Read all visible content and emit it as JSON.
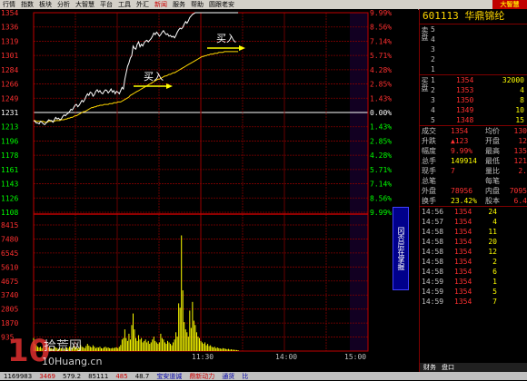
{
  "menu": {
    "items": [
      "行情",
      "指数",
      "板块",
      "分析",
      "大智慧",
      "平台",
      "工具",
      "外汇",
      "新闻",
      "服务",
      "帮助",
      "圆跟老安"
    ],
    "highlight_index": 8,
    "brand": "大智慧"
  },
  "chart": {
    "price_labels": [
      "1354",
      "1336",
      "1319",
      "1301",
      "1284",
      "1266",
      "1249",
      "1231",
      "1213",
      "1196",
      "1178",
      "1161",
      "1143",
      "1126",
      "1108"
    ],
    "pct_labels": [
      "9.99%",
      "8.56%",
      "7.14%",
      "5.71%",
      "4.28%",
      "2.85%",
      "1.43%",
      "0.00%",
      "1.43%",
      "2.85%",
      "4.28%",
      "5.71%",
      "7.14%",
      "8.56%",
      "9.99%"
    ],
    "volume_labels": [
      "8415",
      "7480",
      "6545",
      "5610",
      "4675",
      "3740",
      "2805",
      "1870",
      "935"
    ],
    "time_labels": [
      "11:30",
      "14:00",
      "15:00"
    ],
    "annotations": [
      "买入",
      "买入"
    ],
    "side_button": "冈否层在掌握",
    "price_series": [
      1221,
      1220,
      1218,
      1218,
      1217,
      1220,
      1219,
      1217,
      1216,
      1218,
      1220,
      1222,
      1221,
      1221,
      1219,
      1222,
      1225,
      1223,
      1224,
      1222,
      1223,
      1226,
      1228,
      1227,
      1229,
      1230,
      1232,
      1235,
      1234,
      1237,
      1240,
      1241,
      1238,
      1240,
      1243,
      1246,
      1244,
      1247,
      1251,
      1254,
      1252,
      1256,
      1255,
      1251,
      1253,
      1257,
      1259,
      1256,
      1258,
      1255,
      1254,
      1257,
      1259,
      1258,
      1255,
      1257,
      1260,
      1256,
      1258,
      1254,
      1257,
      1256,
      1254,
      1258,
      1262,
      1260,
      1272,
      1280,
      1288,
      1292,
      1298,
      1301,
      1313,
      1310,
      1309,
      1315,
      1318,
      1312,
      1315,
      1313,
      1317,
      1319,
      1320,
      1318,
      1320,
      1322,
      1325,
      1329,
      1327,
      1330,
      1328,
      1325,
      1327,
      1330,
      1332,
      1329,
      1327,
      1328,
      1325,
      1326,
      1324,
      1325,
      1323,
      1326,
      1330,
      1333,
      1335,
      1334,
      1336,
      1340,
      1343,
      1341,
      1344,
      1348,
      1350,
      1352,
      1353,
      1354,
      1354,
      1354,
      1354,
      1354,
      1354,
      1354,
      1354,
      1354,
      1354,
      1354,
      1354,
      1354,
      1354,
      1354,
      1354,
      1354,
      1354,
      1354,
      1354,
      1354,
      1354,
      1354,
      1354,
      1354,
      1354,
      1354,
      1354,
      1354,
      1354,
      1354,
      1354
    ],
    "avg_series": [
      1221,
      1221,
      1220,
      1220,
      1220,
      1220,
      1220,
      1220,
      1219,
      1219,
      1219,
      1220,
      1220,
      1220,
      1220,
      1220,
      1221,
      1221,
      1221,
      1221,
      1222,
      1222,
      1222,
      1223,
      1223,
      1224,
      1224,
      1225,
      1225,
      1226,
      1227,
      1227,
      1228,
      1229,
      1230,
      1231,
      1232,
      1232,
      1233,
      1234,
      1235,
      1236,
      1237,
      1237,
      1238,
      1238,
      1239,
      1239,
      1240,
      1240,
      1240,
      1241,
      1241,
      1241,
      1241,
      1242,
      1242,
      1242,
      1243,
      1243,
      1243,
      1244,
      1244,
      1244,
      1245,
      1246,
      1247,
      1248,
      1249,
      1250,
      1252,
      1253,
      1254,
      1255,
      1256,
      1257,
      1258,
      1259,
      1260,
      1261,
      1262,
      1263,
      1264,
      1265,
      1266,
      1267,
      1268,
      1269,
      1270,
      1271,
      1272,
      1272,
      1273,
      1274,
      1275,
      1276,
      1276,
      1277,
      1278,
      1278,
      1279,
      1280,
      1280,
      1281,
      1282,
      1283,
      1284,
      1285,
      1286,
      1287,
      1288,
      1289,
      1290,
      1291,
      1292,
      1293,
      1294,
      1295,
      1296,
      1297,
      1298,
      1299,
      1300,
      1300,
      1301,
      1301,
      1302,
      1302,
      1303,
      1303,
      1303,
      1304,
      1304,
      1304,
      1305,
      1305,
      1305,
      1305,
      1306,
      1306,
      1306,
      1306,
      1306,
      1306,
      1306,
      1306,
      1306,
      1306,
      1306
    ],
    "volume_series": [
      900,
      500,
      400,
      300,
      250,
      300,
      200,
      350,
      250,
      300,
      200,
      250,
      180,
      200,
      150,
      300,
      250,
      200,
      150,
      180,
      200,
      220,
      160,
      180,
      250,
      200,
      300,
      260,
      200,
      350,
      260,
      300,
      200,
      250,
      420,
      300,
      260,
      200,
      350,
      500,
      380,
      300,
      250,
      400,
      300,
      200,
      260,
      240,
      300,
      200,
      180,
      260,
      300,
      220,
      250,
      200,
      180,
      220,
      200,
      240,
      260,
      200,
      300,
      420,
      800,
      900,
      1500,
      900,
      700,
      1200,
      800,
      1800,
      2600,
      1500,
      900,
      700,
      1100,
      800,
      900,
      600,
      700,
      800,
      600,
      700,
      500,
      600,
      800,
      1000,
      700,
      600,
      500,
      600,
      1200,
      900,
      800,
      600,
      500,
      700,
      600,
      500,
      400,
      600,
      800,
      1300,
      1000,
      3300,
      3000,
      8000,
      4200,
      2000,
      1500,
      1300,
      1000,
      2800,
      1600,
      3400,
      2100,
      1800,
      1300,
      1000,
      900,
      700,
      600,
      500,
      600,
      400,
      500,
      350,
      400,
      300,
      250,
      300,
      200,
      250,
      200,
      180,
      150,
      200,
      180,
      150,
      120,
      150,
      100,
      120,
      100,
      90,
      80,
      70,
      60
    ]
  },
  "quote": {
    "code": "601113",
    "name": "华鼎锦纶",
    "sell_label": "卖盘",
    "buy_label": "买盘",
    "sell": [
      {
        "level": "5",
        "price": "",
        "vol": ""
      },
      {
        "level": "4",
        "price": "",
        "vol": ""
      },
      {
        "level": "3",
        "price": "",
        "vol": ""
      },
      {
        "level": "2",
        "price": "",
        "vol": ""
      },
      {
        "level": "1",
        "price": "",
        "vol": ""
      }
    ],
    "buy": [
      {
        "level": "1",
        "price": "1354",
        "vol": "32000"
      },
      {
        "level": "2",
        "price": "1353",
        "vol": "4"
      },
      {
        "level": "3",
        "price": "1350",
        "vol": "8"
      },
      {
        "level": "4",
        "price": "1349",
        "vol": "10"
      },
      {
        "level": "5",
        "price": "1348",
        "vol": "15"
      }
    ],
    "stats": [
      {
        "l1": "成交",
        "v1": "1354",
        "l2": "均价",
        "v2": "130"
      },
      {
        "l1": "升跌",
        "v1": "▲123",
        "l2": "开盘",
        "v2": "12"
      },
      {
        "l1": "幅度",
        "v1": "9.99%",
        "l2": "最高",
        "v2": "135"
      },
      {
        "l1": "总手",
        "v1": "149914",
        "l2": "最低",
        "v2": "121"
      },
      {
        "l1": "现手",
        "v1": "7",
        "l2": "量比",
        "v2": "2."
      },
      {
        "l1": "总笔",
        "v1": "",
        "l2": "每笔",
        "v2": ""
      },
      {
        "l1": "外盘",
        "v1": "78956",
        "l2": "内盘",
        "v2": "7095"
      },
      {
        "l1": "换手",
        "v1": "23.42%",
        "l2": "股本",
        "v2": "6.4"
      }
    ],
    "ticks": [
      {
        "time": "14:56",
        "price": "1354",
        "vol": "24"
      },
      {
        "time": "14:57",
        "price": "1354",
        "vol": "4"
      },
      {
        "time": "14:58",
        "price": "1354",
        "vol": "11"
      },
      {
        "time": "14:58",
        "price": "1354",
        "vol": "20"
      },
      {
        "time": "14:58",
        "price": "1354",
        "vol": "12"
      },
      {
        "time": "14:58",
        "price": "1354",
        "vol": "2"
      },
      {
        "time": "14:58",
        "price": "1354",
        "vol": "6"
      },
      {
        "time": "14:59",
        "price": "1354",
        "vol": "1"
      },
      {
        "time": "14:59",
        "price": "1354",
        "vol": "5"
      },
      {
        "time": "14:59",
        "price": "1354",
        "vol": "7"
      }
    ],
    "tabs": [
      "财务",
      "盘口"
    ]
  },
  "status": {
    "items": [
      "1169983",
      "3469",
      "579.2",
      "85111",
      "485",
      "48.7",
      "宝安道诚",
      "鼎新动力",
      "通货",
      "比"
    ],
    "watermark": "拾荒网",
    "watermark_url": "10Huang.cn"
  },
  "colors": {
    "up": "#ff3030",
    "down": "#00ff00",
    "grid": "#800000",
    "price": "#ffffff",
    "avg": "#ffd700",
    "volume": "#ffff00"
  }
}
